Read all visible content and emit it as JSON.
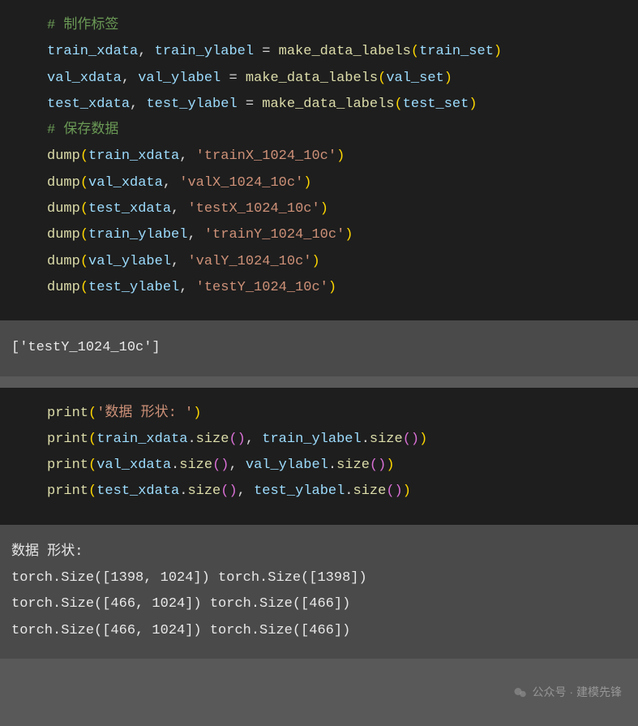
{
  "block1": {
    "c1": "# 制作标签",
    "l1": {
      "v1": "train_xdata",
      "v2": "train_ylabel",
      "fn": "make_data_labels",
      "arg": "train_set"
    },
    "l2": {
      "v1": "val_xdata",
      "v2": "val_ylabel",
      "fn": "make_data_labels",
      "arg": "val_set"
    },
    "l3": {
      "v1": "test_xdata",
      "v2": "test_ylabel",
      "fn": "make_data_labels",
      "arg": "test_set"
    },
    "c2": "# 保存数据",
    "d1": {
      "fn": "dump",
      "arg": "train_xdata",
      "str": "'trainX_1024_10c'"
    },
    "d2": {
      "fn": "dump",
      "arg": "val_xdata",
      "str": "'valX_1024_10c'"
    },
    "d3": {
      "fn": "dump",
      "arg": "test_xdata",
      "str": "'testX_1024_10c'"
    },
    "d4": {
      "fn": "dump",
      "arg": "train_ylabel",
      "str": "'trainY_1024_10c'"
    },
    "d5": {
      "fn": "dump",
      "arg": "val_ylabel",
      "str": "'valY_1024_10c'"
    },
    "d6": {
      "fn": "dump",
      "arg": "test_ylabel",
      "str": "'testY_1024_10c'"
    }
  },
  "output1": "['testY_1024_10c']",
  "block2": {
    "p1": {
      "fn": "print",
      "str": "'数据 形状: '"
    },
    "p2": {
      "fn": "print",
      "a1": "train_xdata",
      "m1": "size",
      "a2": "train_ylabel",
      "m2": "size"
    },
    "p3": {
      "fn": "print",
      "a1": "val_xdata",
      "m1": "size",
      "a2": "val_ylabel",
      "m2": "size"
    },
    "p4": {
      "fn": "print",
      "a1": "test_xdata",
      "m1": "size",
      "a2": "test_ylabel",
      "m2": "size"
    }
  },
  "output2": {
    "l1": "数据 形状:",
    "l2": "torch.Size([1398, 1024]) torch.Size([1398])",
    "l3": "torch.Size([466, 1024]) torch.Size([466])",
    "l4": "torch.Size([466, 1024]) torch.Size([466])"
  },
  "watermark": "公众号 · 建模先锋"
}
